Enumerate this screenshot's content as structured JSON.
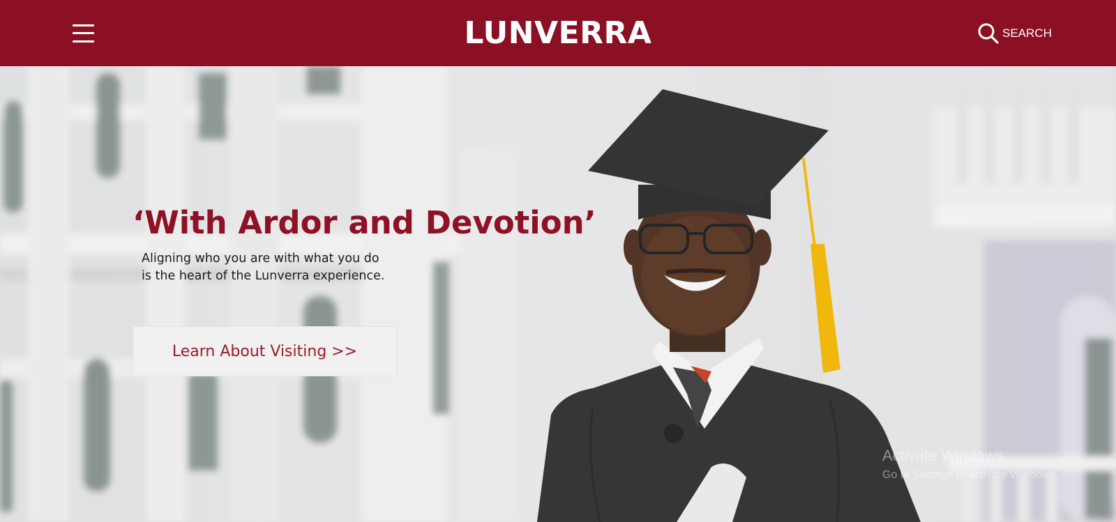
{
  "header": {
    "logo": "LUNVERRA",
    "search_label": "SEARCH",
    "menu_icon": "hamburger-menu-icon",
    "search_icon": "search-icon"
  },
  "hero": {
    "headline": "‘With Ardor and Devotion’",
    "subtext_line1": "Aligning who you are with what you do",
    "subtext_line2": "is the heart of the Lunverra experience.",
    "cta_label": "Learn About Visiting >>",
    "image": "graduate-in-cap-and-gown-photo"
  },
  "watermark": {
    "title": "Activate Windows",
    "subtitle": "Go to Settings to activate Windows."
  },
  "colors": {
    "brand": "#8b1024",
    "headline": "#8e1126",
    "cta_text": "#9b1a2c",
    "cta_bg": "#f1f1f1",
    "tassel": "#f0b400"
  }
}
